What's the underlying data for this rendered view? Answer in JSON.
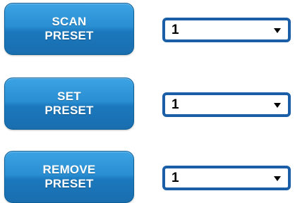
{
  "presets": [
    {
      "button_label": "SCAN\nPRESET",
      "selected_value": "1"
    },
    {
      "button_label": "SET\nPRESET",
      "selected_value": "1"
    },
    {
      "button_label": "REMOVE\nPRESET",
      "selected_value": "1"
    }
  ],
  "icons": {
    "dropdown": "chevron-down-icon"
  },
  "colors": {
    "button_gradient_top": "#3ba3e3",
    "button_gradient_bottom": "#1a6eae",
    "select_border": "#1a5ea8"
  }
}
